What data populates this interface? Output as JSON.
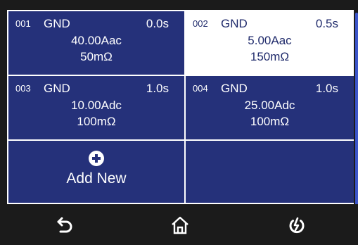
{
  "steps": [
    {
      "num": "001",
      "mode": "GND",
      "time": "0.0s",
      "current": "40.00Aac",
      "resistance": "50mΩ"
    },
    {
      "num": "002",
      "mode": "GND",
      "time": "0.5s",
      "current": "5.00Aac",
      "resistance": "150mΩ"
    },
    {
      "num": "003",
      "mode": "GND",
      "time": "1.0s",
      "current": "10.00Adc",
      "resistance": "100mΩ"
    },
    {
      "num": "004",
      "mode": "GND",
      "time": "1.0s",
      "current": "25.00Adc",
      "resistance": "100mΩ"
    }
  ],
  "add_new": {
    "label": "Add New",
    "icon": "plus-circle-icon"
  },
  "nav": {
    "back_icon": "back-arrow-icon",
    "home_icon": "home-icon",
    "power_icon": "power-icon"
  },
  "colors": {
    "background": "#1b1b1b",
    "cell": "#25317a",
    "selected_cell": "#ffffff",
    "scrollbar": "#3c55c9"
  }
}
